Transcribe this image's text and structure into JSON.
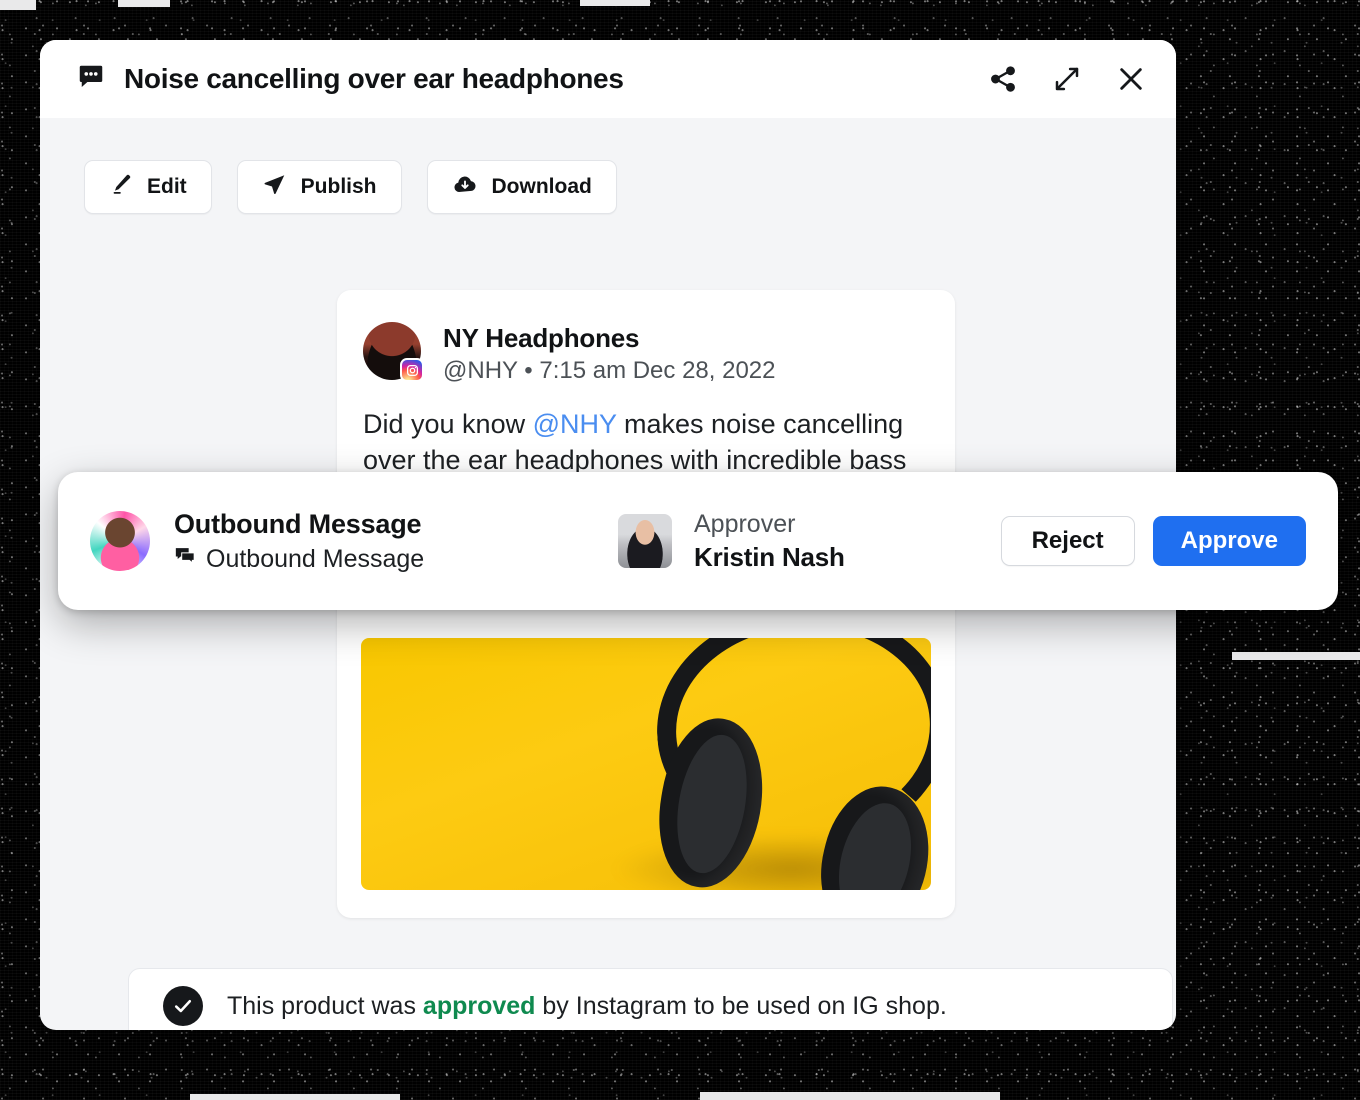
{
  "header": {
    "icon": "chat-bubble-icon",
    "title": "Noise cancelling over ear headphones",
    "actions": [
      {
        "name": "share-icon",
        "label": "Share"
      },
      {
        "name": "expand-icon",
        "label": "Expand"
      },
      {
        "name": "close-icon",
        "label": "Close"
      }
    ]
  },
  "toolbar": {
    "edit_label": "Edit",
    "publish_label": "Publish",
    "download_label": "Download",
    "edit_icon": "pencil-icon",
    "publish_icon": "paper-plane-icon",
    "download_icon": "cloud-download-icon"
  },
  "post": {
    "author": "NY Headphones",
    "meta": "@NHY • 7:15 am Dec 28, 2022",
    "handle": "@NHY",
    "timestamp": "7:15 am Dec 28, 2022",
    "platform_badge": "instagram-icon",
    "body_before": "Did you know ",
    "body_mention": "@NHY",
    "body_after": " makes noise cancelling over the ear headphones with incredible bass and sound quality?",
    "image_alt": "Black over-ear headphones on a yellow background"
  },
  "approval": {
    "title": "Outbound Message",
    "subtitle": "Outbound Message",
    "subtitle_icon": "forum-icon",
    "approver_label": "Approver",
    "approver_name": "Kristin Nash",
    "reject_label": "Reject",
    "approve_label": "Approve",
    "approve_color": "#1f6ff0"
  },
  "status": {
    "icon": "check-circle-icon",
    "text_before": "This product was ",
    "highlight": "approved",
    "text_after": " by Instagram to be used on IG shop.",
    "highlight_color": "#0f8a4f"
  }
}
